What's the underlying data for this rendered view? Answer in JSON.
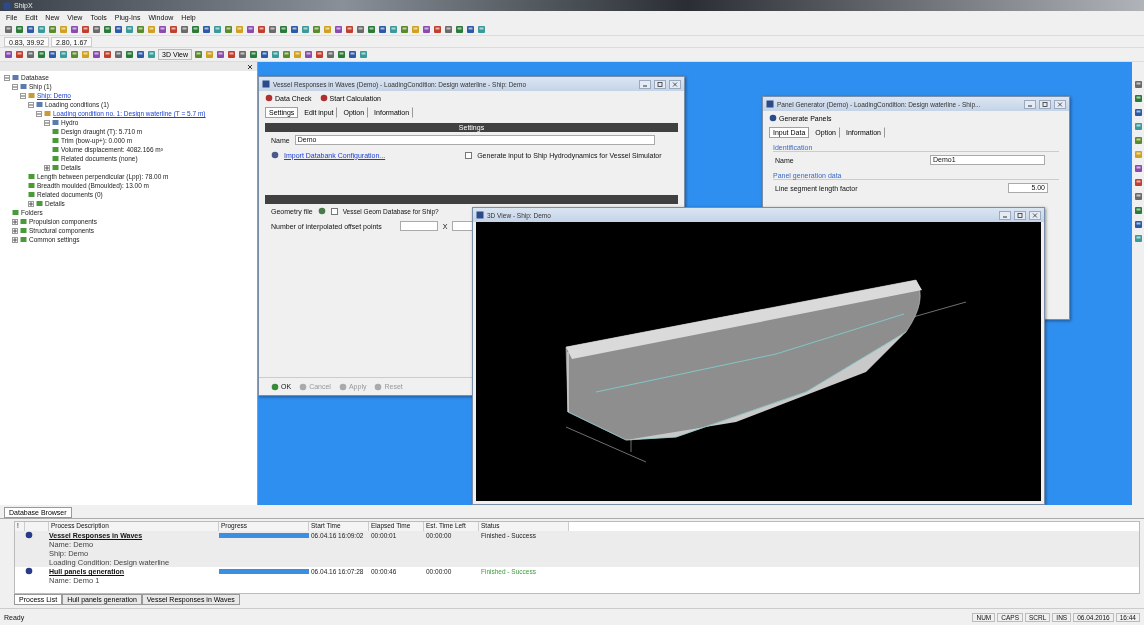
{
  "window": {
    "title": "ShipX"
  },
  "menu": [
    "File",
    "Edit",
    "New",
    "View",
    "Tools",
    "Plug-Ins",
    "Window",
    "Help"
  ],
  "coordinates": [
    "0.83, 39.92",
    "2.80, 1.67"
  ],
  "toolbar_view_button": "3D View",
  "tree": [
    {
      "label": "Database",
      "expanded": true,
      "children": [
        {
          "label": "Ship (1)",
          "expanded": true,
          "children": [
            {
              "label": "Ship: Demo",
              "link": true,
              "expanded": true,
              "children": [
                {
                  "label": "Loading conditions (1)",
                  "expanded": true,
                  "children": [
                    {
                      "label": "Loading condition no. 1: Design waterline (T = 5.7 m)",
                      "link": true,
                      "expanded": true,
                      "children": [
                        {
                          "label": "Hydro",
                          "expanded": true,
                          "children": [
                            {
                              "label": "Design draught (T): 5.710 m"
                            },
                            {
                              "label": "Trim (bow-up+): 0.000 m"
                            },
                            {
                              "label": "Volume displacement: 4082.166 m³"
                            },
                            {
                              "label": "Related documents (none)"
                            }
                          ]
                        },
                        {
                          "label": "Details",
                          "expanded": false
                        }
                      ]
                    }
                  ]
                },
                {
                  "label": "Length between perpendicular (Lpp): 78.00 m"
                },
                {
                  "label": "Breadth moulded (Bmoulded): 13.00 m"
                },
                {
                  "label": "Related documents (0)"
                },
                {
                  "label": "Details",
                  "expanded": false
                }
              ]
            }
          ]
        },
        {
          "label": "Folders"
        },
        {
          "label": "Propulsion components",
          "expanded": false
        },
        {
          "label": "Structural components",
          "expanded": false
        },
        {
          "label": "Common settings",
          "expanded": false
        }
      ]
    }
  ],
  "vessel_window": {
    "title": "Vessel Responses in Waves (Demo) - LoadingCondition: Design waterline - Ship: Demo",
    "actions": [
      "Data Check",
      "Start Calculation"
    ],
    "tabs": [
      {
        "label": "Settings",
        "selected": true
      },
      {
        "label": "Edit input",
        "selected": false
      },
      {
        "label": "Option",
        "selected": false
      },
      {
        "label": "Information",
        "selected": false
      }
    ],
    "section": "Settings",
    "name_label": "Name",
    "name_value": "Demo",
    "import_link": "Import Databank Configuration...",
    "simulator_checkbox": {
      "label": "Generate input to Ship Hydrodynamics for Vessel Simulator",
      "checked": false
    },
    "geometry_label": "Geometry file",
    "geometry_option": {
      "label": "Vessel Geom Database for Ship?",
      "checked": false
    },
    "offset_label": "Number of interpolated offset points",
    "offset_separator": "X",
    "buttons": [
      {
        "label": "OK",
        "disabled": false
      },
      {
        "label": "Cancel",
        "disabled": true
      },
      {
        "label": "Apply",
        "disabled": true
      },
      {
        "label": "Reset",
        "disabled": true
      }
    ]
  },
  "panel_window": {
    "title": "Panel Generator (Demo) - LoadingCondition: Design waterline - Ship...",
    "action": "Generate Panels",
    "tabs": [
      {
        "label": "Input Data",
        "selected": true
      },
      {
        "label": "Option",
        "selected": false
      },
      {
        "label": "Information",
        "selected": false
      }
    ],
    "identification": "Identification",
    "name_label": "Name",
    "name_value": "Demo1",
    "generation": "Panel generation data",
    "segment_label": "Line segment length factor",
    "segment_value": "5.00"
  },
  "view_window": {
    "title": "3D View - Ship: Demo"
  },
  "browser_tab": "Database Browser",
  "process_columns": [
    "!",
    "Process Description",
    "Progress",
    "Start Time",
    "Elapsed Time",
    "Est. Time Left",
    "Status"
  ],
  "processes": [
    {
      "title": "Vessel Responses in Waves",
      "details": [
        "Name: Demo",
        "Ship: Demo",
        "Loading Condition: Design waterline"
      ],
      "level": 1,
      "start": "06.04.16 16:09:02",
      "elapsed": "00:00:01",
      "left": "00:00:00",
      "status": "Finished - Success",
      "selected": true
    },
    {
      "title": "Hull panels generation",
      "details": [
        "Name: Demo 1"
      ],
      "level": 1,
      "start": "06.04.16 16:07:28",
      "elapsed": "00:00:46",
      "left": "00:00:00",
      "status": "Finished - Success",
      "selected": false
    }
  ],
  "process_tabs": [
    {
      "label": "Process List",
      "selected": true
    },
    {
      "label": "Hull panels generation",
      "selected": false
    },
    {
      "label": "Vessel Responses in Waves",
      "selected": false
    }
  ],
  "status_bar": {
    "text": "Ready",
    "cells": [
      "NUM",
      "CAPS",
      "SCRL",
      "INS",
      "06.04.2016",
      "16:44"
    ]
  }
}
